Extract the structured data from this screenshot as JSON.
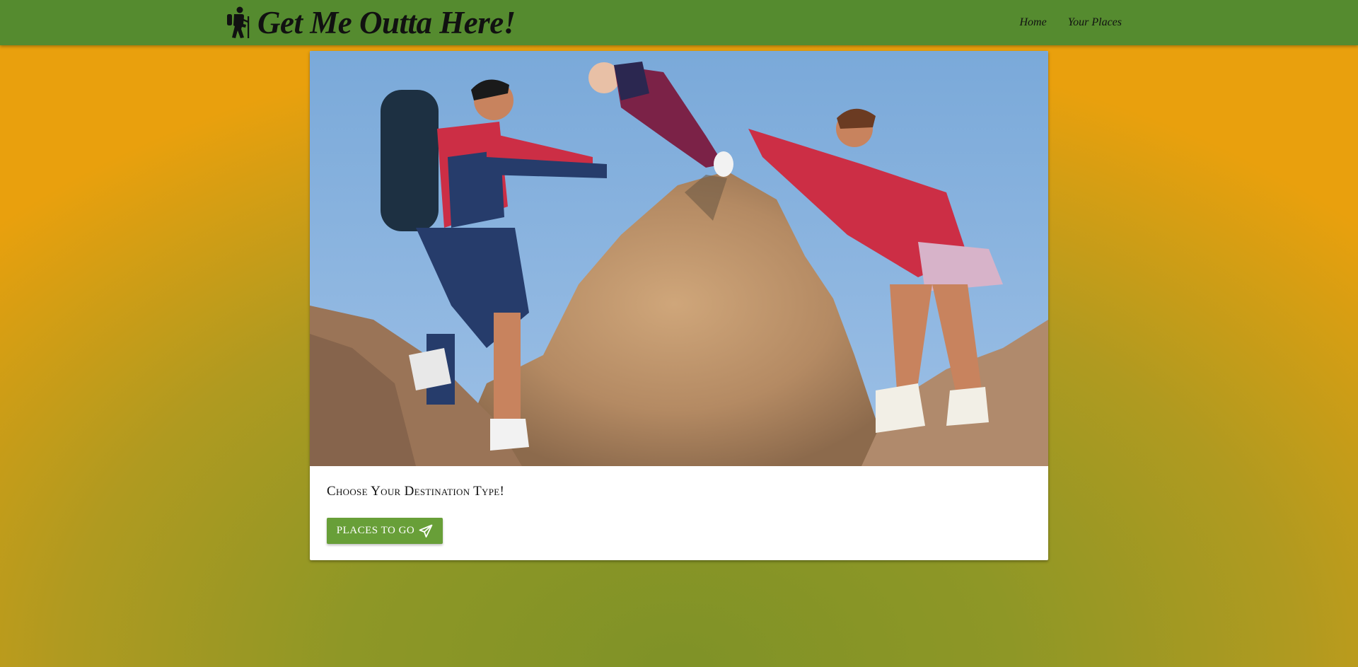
{
  "colors": {
    "navbar": "#558b2f",
    "button": "#689f38",
    "background_top": "#e9a00d",
    "background_bottom": "#7f9227"
  },
  "header": {
    "brand_icon": "hiking-icon",
    "brand_title": "Get Me Outta Here!",
    "nav": [
      {
        "label": "Home"
      },
      {
        "label": "Your Places"
      }
    ]
  },
  "hero_card": {
    "image": "family-hiking-photo",
    "title": "Choose Your Destination Type!",
    "button_label": "PLACES TO GO",
    "button_icon": "paper-plane-icon"
  }
}
